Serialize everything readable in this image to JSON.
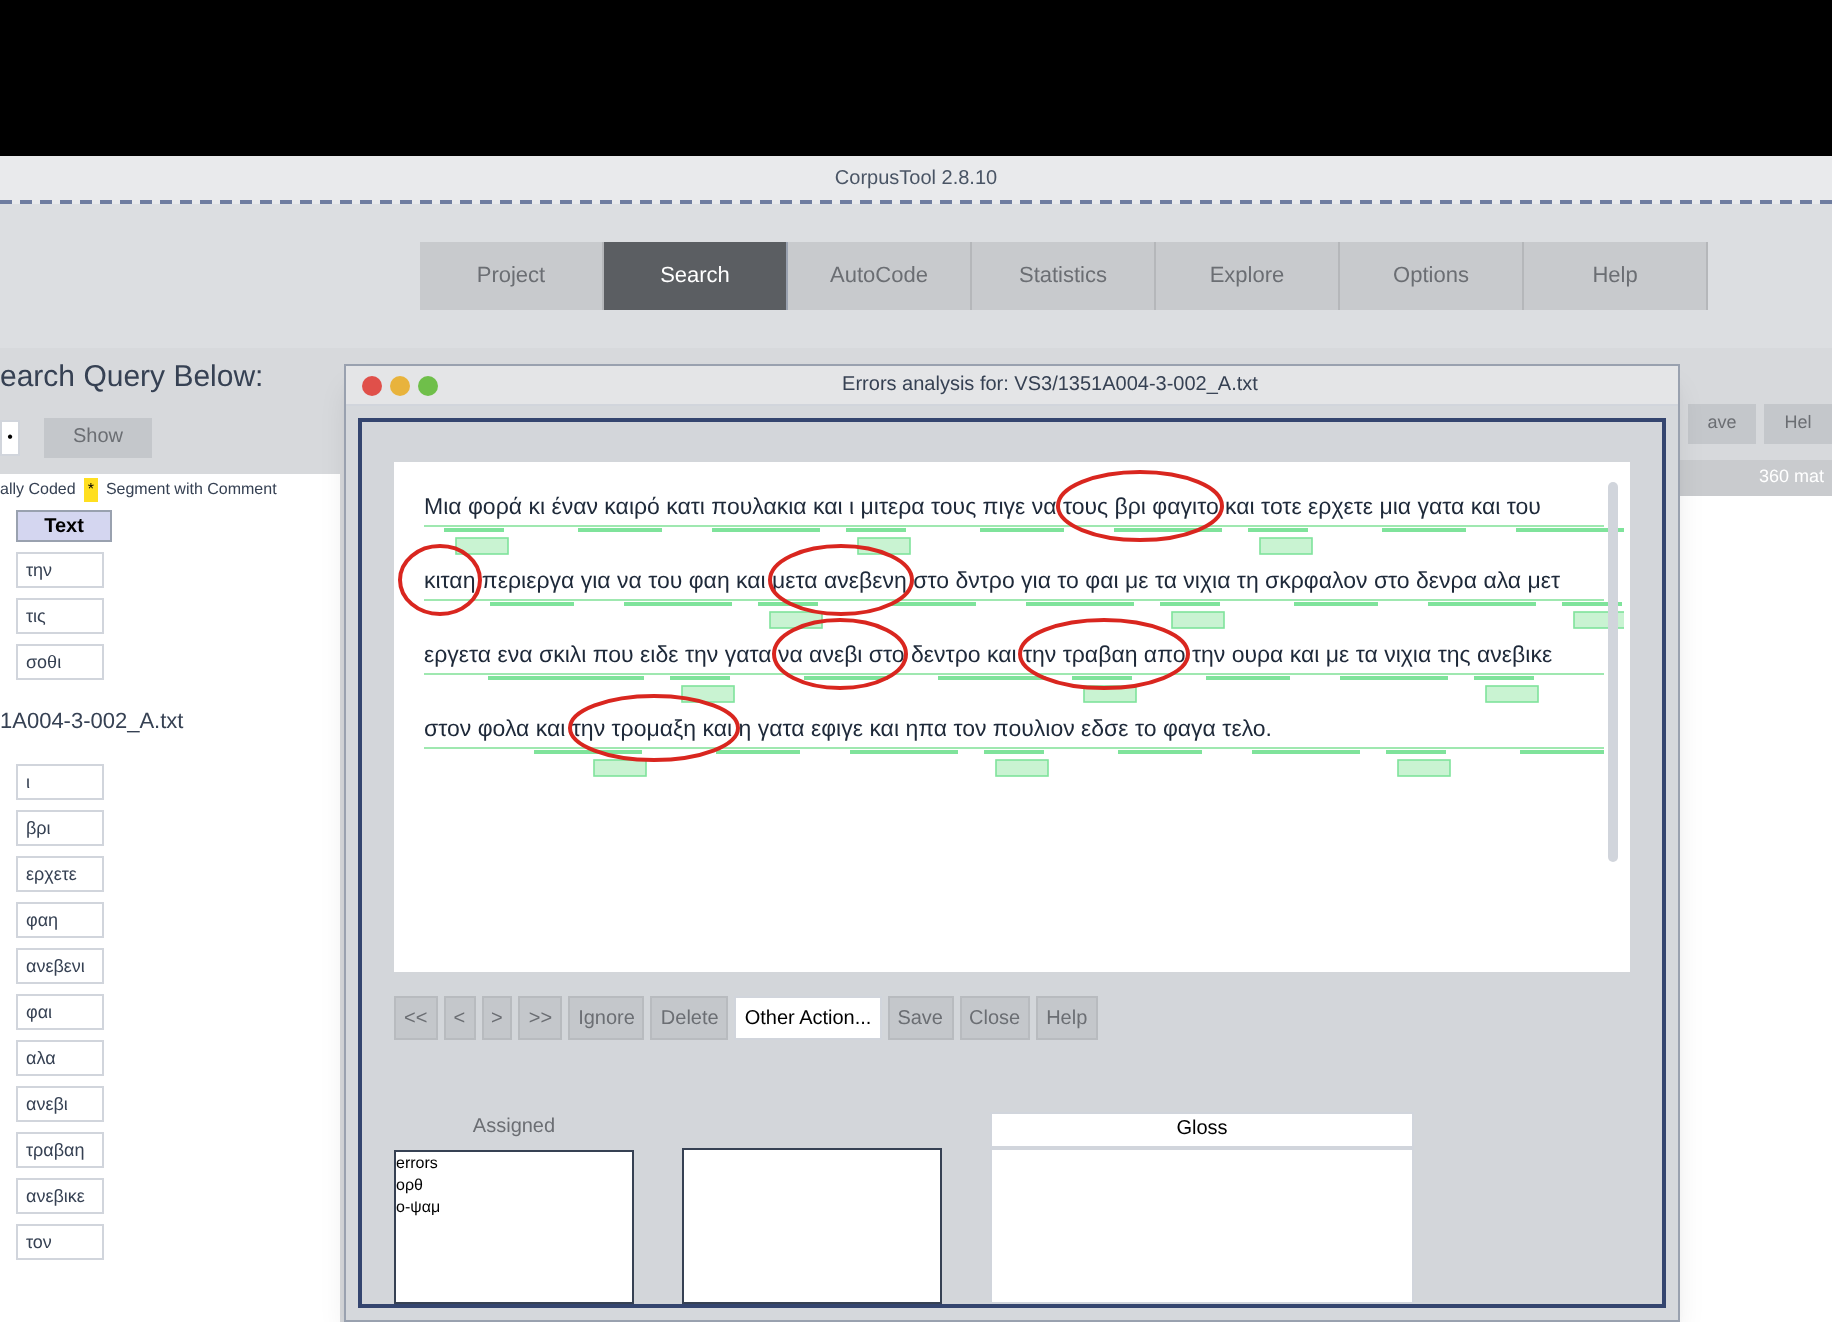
{
  "app_title": "CorpusTool 2.8.10",
  "tabs": [
    {
      "label": "Project",
      "selected": false
    },
    {
      "label": "Search",
      "selected": true
    },
    {
      "label": "AutoCode",
      "selected": false
    },
    {
      "label": "Statistics",
      "selected": false
    },
    {
      "label": "Explore",
      "selected": false
    },
    {
      "label": "Options",
      "selected": false
    },
    {
      "label": "Help",
      "selected": false
    }
  ],
  "left_panel": {
    "heading": "earch Query Below:",
    "toggle": "•",
    "show_button": "Show",
    "legend_left": "ally Coded",
    "legend_mark": "*",
    "legend_right": "Segment with Comment",
    "column_header": "Text",
    "cells_top": [
      "την",
      "τις",
      "σοθι"
    ],
    "file_name": "1A004-3-002_A.txt",
    "cells_bottom": [
      "ι",
      "βρι",
      "ερχετε",
      "φαη",
      "ανεβενι",
      "φαι",
      "αλα",
      "ανεβι",
      "τραβαη",
      "ανεβικε",
      "τον"
    ]
  },
  "right_panel": {
    "buttons": [
      "ave",
      "Hel"
    ],
    "count": "360 mat"
  },
  "dialog": {
    "title": "Errors analysis for: VS3/1351A004-3-002_A.txt",
    "text_lines": [
      "Μια φορά κι έναν καιρό κατι πουλακια και ι μιτερα τους πιγε να τους βρι φαγιτο και τοτε ερχετε μια γατα και του",
      "κιταη περιεργα για να του φαη και μετα ανεβενη στο δντρο για το φαι με τα νιχια τη σκρφαλον στο δενρα αλα μετ",
      "εργετα ενα σκιλι που ειδε την γατα να ανεβι στο δεντρο και την τραβαη απο την ουρα και με τα νιχια της ανεβικε",
      "στον φολα και την τρομαξη και η γατα εφιγε και ηπα τον πουλιον εδσε το φαγα τελο."
    ],
    "buttons": [
      {
        "label": "<<",
        "disabled": true
      },
      {
        "label": "<",
        "disabled": true
      },
      {
        "label": ">",
        "disabled": true
      },
      {
        "label": ">>",
        "disabled": true
      },
      {
        "label": "Ignore",
        "disabled": true
      },
      {
        "label": "Delete",
        "disabled": true
      },
      {
        "label": "Other Action...",
        "disabled": false
      },
      {
        "label": "Save",
        "disabled": true
      },
      {
        "label": "Close",
        "disabled": true
      },
      {
        "label": "Help",
        "disabled": true
      }
    ],
    "assigned_label": "Assigned",
    "assigned_items": [
      "errors",
      "ορθ",
      "ο-ψαμ"
    ],
    "gloss_header": "Gloss"
  }
}
